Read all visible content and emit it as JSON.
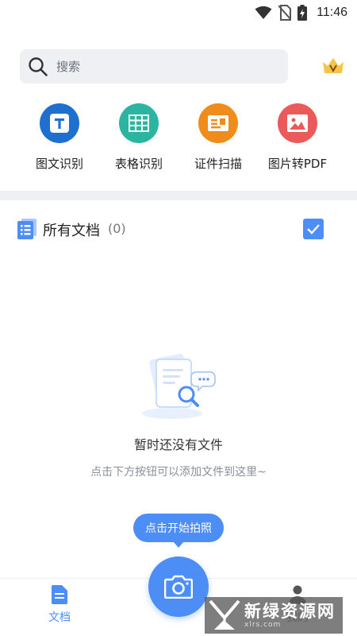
{
  "status_bar": {
    "time": "11:46",
    "icons": [
      "wifi-icon",
      "no-sim-icon",
      "battery-charging-icon"
    ]
  },
  "search": {
    "placeholder": "搜索",
    "icon": "search-icon"
  },
  "vip": {
    "icon": "crown-icon",
    "letter": "V"
  },
  "tools": [
    {
      "label": "图文识别",
      "icon": "text-recognition-icon",
      "color": "#1f6fd1"
    },
    {
      "label": "表格识别",
      "icon": "table-recognition-icon",
      "color": "#2bb5a1"
    },
    {
      "label": "证件扫描",
      "icon": "id-card-scan-icon",
      "color": "#f08c1c"
    },
    {
      "label": "图片转PDF",
      "icon": "image-to-pdf-icon",
      "color": "#ea5a5a"
    }
  ],
  "documents": {
    "title": "所有文档",
    "count": "(0)",
    "icon": "document-list-icon",
    "select_icon": "checkbox-icon"
  },
  "empty_state": {
    "title": "暂时还没有文件",
    "subtitle": "点击下方按钮可以添加文件到这里~",
    "icon": "empty-files-icon"
  },
  "capture": {
    "tooltip": "点击开始拍照",
    "icon": "camera-icon"
  },
  "bottom_nav": {
    "docs_label": "文档",
    "docs_icon": "document-icon",
    "me_icon": "person-icon",
    "me_label": "我的"
  },
  "watermark": {
    "text": "新绿资源网",
    "sub": "xlrs.com"
  },
  "colors": {
    "accent": "#4c8df6",
    "band": "#eef0f4"
  }
}
